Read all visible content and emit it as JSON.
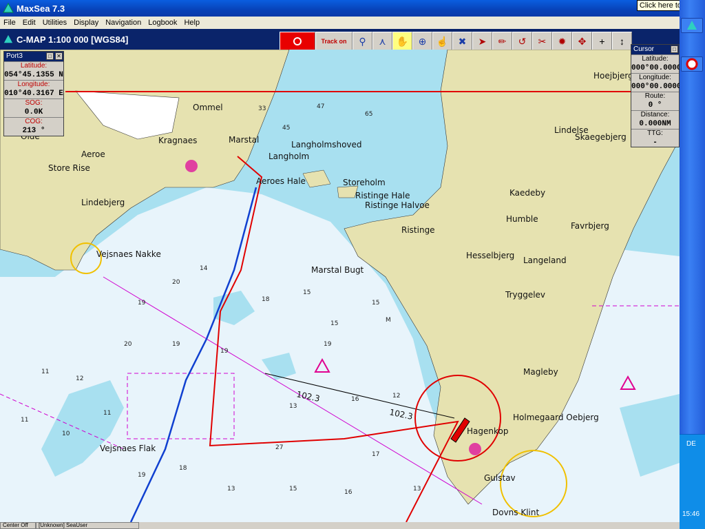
{
  "window": {
    "title": "MaxSea 7.3",
    "click_here": "Click here to begin"
  },
  "menu": [
    "File",
    "Edit",
    "Utilities",
    "Display",
    "Navigation",
    "Logbook",
    "Help"
  ],
  "chart_header": {
    "title": "C-MAP  1:100 000 [WGS84]"
  },
  "toolbar": {
    "track_label": "Track on"
  },
  "port_panel": {
    "title": "Port3",
    "latitude_label": "Latitude:",
    "latitude": "054°45.1355 N",
    "longitude_label": "Longitude:",
    "longitude": "010°40.3167 E",
    "sog_label": "SOG:",
    "sog": "0.0K",
    "cog_label": "COG:",
    "cog": "213 °"
  },
  "cursor_panel": {
    "title": "Cursor",
    "latitude_label": "Latitude:",
    "latitude": "000°00.0000",
    "longitude_label": "Longitude:",
    "longitude": "000°00.0000",
    "route_label": "Route:",
    "route": "0 °",
    "distance_label": "Distance:",
    "distance": "0.000NM",
    "ttg_label": "TTG:",
    "ttg": "-"
  },
  "map_labels": {
    "ommel": "Ommel",
    "kragnaes": "Kragnaes",
    "marstal": "Marstal",
    "aeroe": "Aeroe",
    "store_rise": "Store Rise",
    "lindebjerg": "Lindebjerg",
    "olde": "Olde",
    "langholmshoved": "Langholmshoved",
    "langholm": "Langholm",
    "aeroes_hale": "Aeroes Hale",
    "storeholm": "Storeholm",
    "ristinge_hale": "Ristinge Hale",
    "ristinge_halvoe": "Ristinge Halvoe",
    "ristinge": "Ristinge",
    "kaedeby": "Kaedeby",
    "humble": "Humble",
    "favrbjerg": "Favrbjerg",
    "hesselbjerg": "Hesselbjerg",
    "langeland": "Langeland",
    "tryggelev": "Tryggelev",
    "vejsnaes_nakke": "Vejsnaes Nakke",
    "marstal_bugt": "Marstal Bugt",
    "magleby": "Magleby",
    "hagenkop": "Hagenkop",
    "holmegaard": "Holmegaard Oebjerg",
    "gulstav": "Gulstav",
    "dovns_klint": "Dovns Klint",
    "vejsnaes_flak": "Vejsnaes Flak",
    "lindelse": "Lindelse",
    "skaegebjerg": "Skaegebjerg",
    "hoejbjerg": "Hoejbjerg",
    "bearing1": "102.3",
    "bearing2": "102.3"
  },
  "status": {
    "cell1": "Center Off",
    "cell2": "[Unknown] SeaUser"
  },
  "taskbar": {
    "lang": "DE",
    "time": "15:46"
  },
  "colors": {
    "land": "#e6e2b0",
    "shallow": "#a8e0f0",
    "deep": "#e8f4fb",
    "track_red": "#e00000",
    "track_blue": "#1040d0"
  }
}
